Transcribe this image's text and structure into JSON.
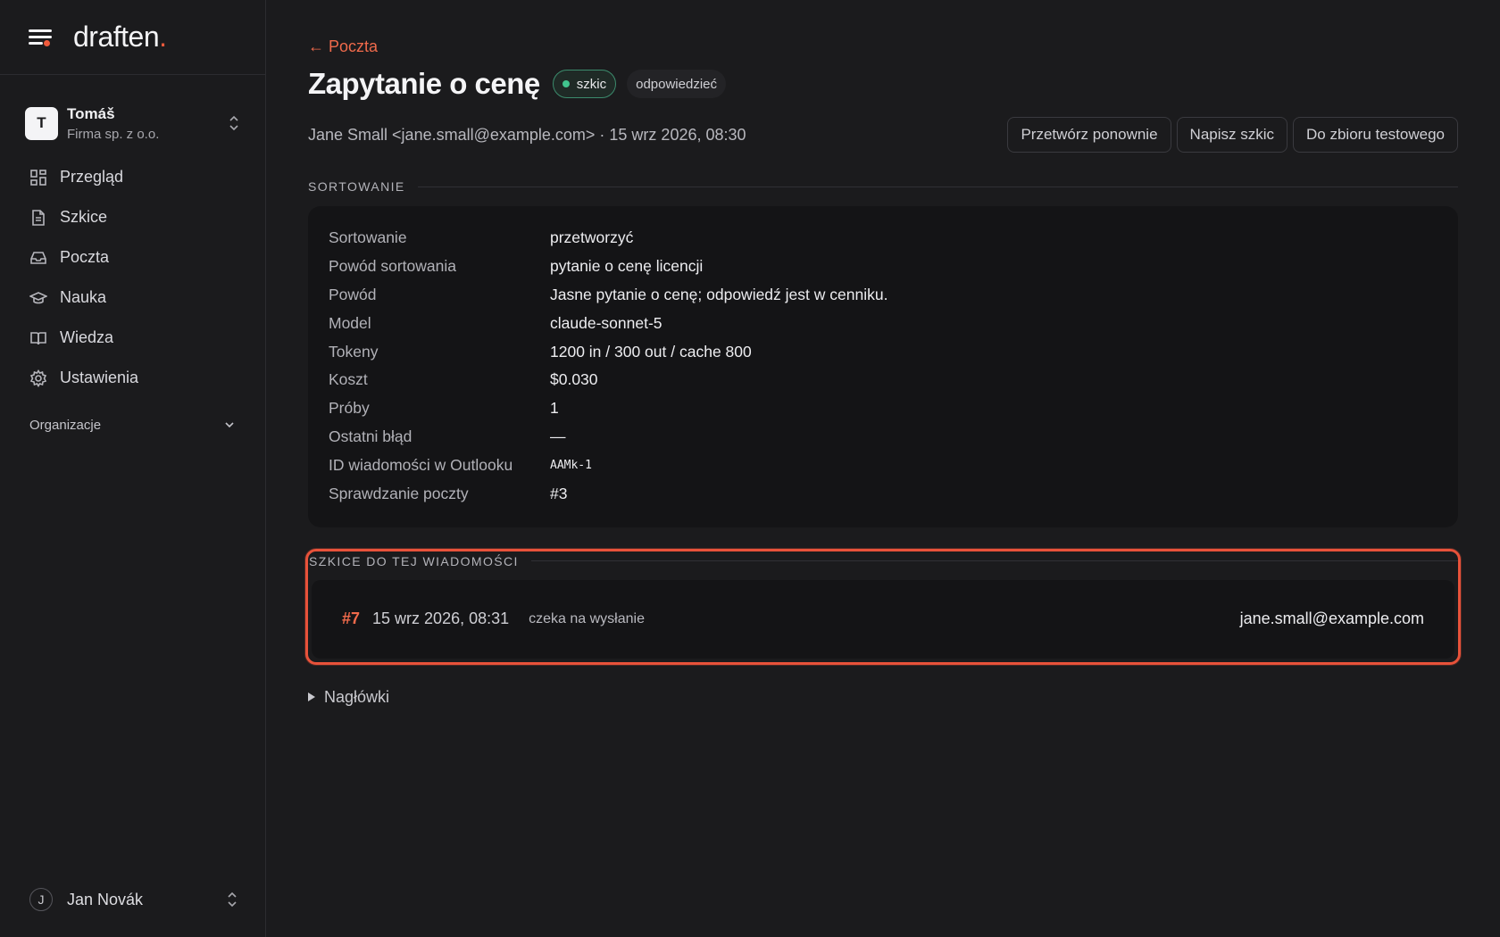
{
  "brand": {
    "name": "draften",
    "dot": ".",
    "accent_color": "#ef5a3c"
  },
  "org": {
    "initial": "T",
    "name": "Tomáš",
    "subtitle": "Firma sp. z o.o."
  },
  "sidebar": {
    "items": [
      {
        "label": "Przegląd",
        "icon": "dashboard-icon"
      },
      {
        "label": "Szkice",
        "icon": "document-icon"
      },
      {
        "label": "Poczta",
        "icon": "inbox-icon"
      },
      {
        "label": "Nauka",
        "icon": "graduation-cap-icon"
      },
      {
        "label": "Wiedza",
        "icon": "book-icon"
      },
      {
        "label": "Ustawienia",
        "icon": "gear-icon"
      }
    ],
    "section_label": "Organizacje"
  },
  "user": {
    "initial": "J",
    "name": "Jan Novák"
  },
  "main": {
    "back_label": "← Poczta",
    "title": "Zapytanie o cenę",
    "badge_status": "szkic",
    "badge_status_color": "#41c48e",
    "badge_tag": "odpowiedzieć",
    "meta": "Jane Small <jane.small@example.com> · 15 wrz 2026, 08:30",
    "actions": {
      "reprocess": "Przetwórz ponownie",
      "write_draft": "Napisz szkic",
      "to_test_set": "Do zbioru testowego"
    },
    "sorting_section": "SORTOWANIE",
    "details": [
      {
        "key": "Sortowanie",
        "value": "przetworzyć"
      },
      {
        "key": "Powód sortowania",
        "value": "pytanie o cenę licencji"
      },
      {
        "key": "Powód",
        "value": "Jasne pytanie o cenę; odpowiedź jest w cenniku."
      },
      {
        "key": "Model",
        "value": "claude-sonnet-5"
      },
      {
        "key": "Tokeny",
        "value": "1200 in / 300 out / cache 800"
      },
      {
        "key": "Koszt",
        "value": "$0.030"
      },
      {
        "key": "Próby",
        "value": "1"
      },
      {
        "key": "Ostatni błąd",
        "value": "—"
      },
      {
        "key": "ID wiadomości w Outlooku",
        "value": "AAMk-1"
      },
      {
        "key": "Sprawdzanie poczty",
        "value": "#3"
      }
    ],
    "drafts_section": "SZKICE DO TEJ WIADOMOŚCI",
    "drafts": [
      {
        "number": "#7",
        "date": "15 wrz 2026, 08:31",
        "status": "czeka na wysłanie",
        "to": "jane.small@example.com"
      }
    ],
    "headers_toggle": "Nagłówki"
  }
}
